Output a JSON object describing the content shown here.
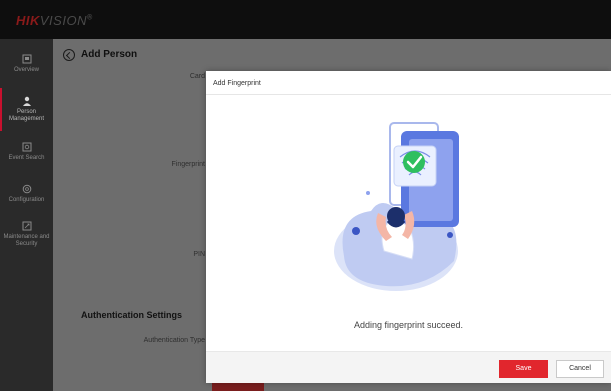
{
  "brand": {
    "hik": "HIK",
    "vision": "VISION",
    "reg": "®"
  },
  "sidebar": {
    "items": [
      {
        "label": "Overview",
        "icon": "overview-icon"
      },
      {
        "label": "Person Management",
        "icon": "person-icon",
        "active": true
      },
      {
        "label": "Event Search",
        "icon": "event-search-icon"
      },
      {
        "label": "Configuration",
        "icon": "gear-icon"
      },
      {
        "label": "Maintenance and Security",
        "icon": "maintenance-icon"
      }
    ]
  },
  "page": {
    "title": "Add Person",
    "labels": {
      "card": "Card",
      "fingerprint": "Fingerprint",
      "pin": "PIN",
      "auth_type": "Authentication Type"
    },
    "section_title": "Authentication Settings"
  },
  "modal": {
    "title": "Add Fingerprint",
    "message": "Adding fingerprint succeed.",
    "save": "Save",
    "cancel": "Cancel"
  },
  "colors": {
    "accent": "#e1262d",
    "brand_red": "#c8102e",
    "illus_blue": "#5a78e0",
    "success_green": "#2fbf5f"
  }
}
